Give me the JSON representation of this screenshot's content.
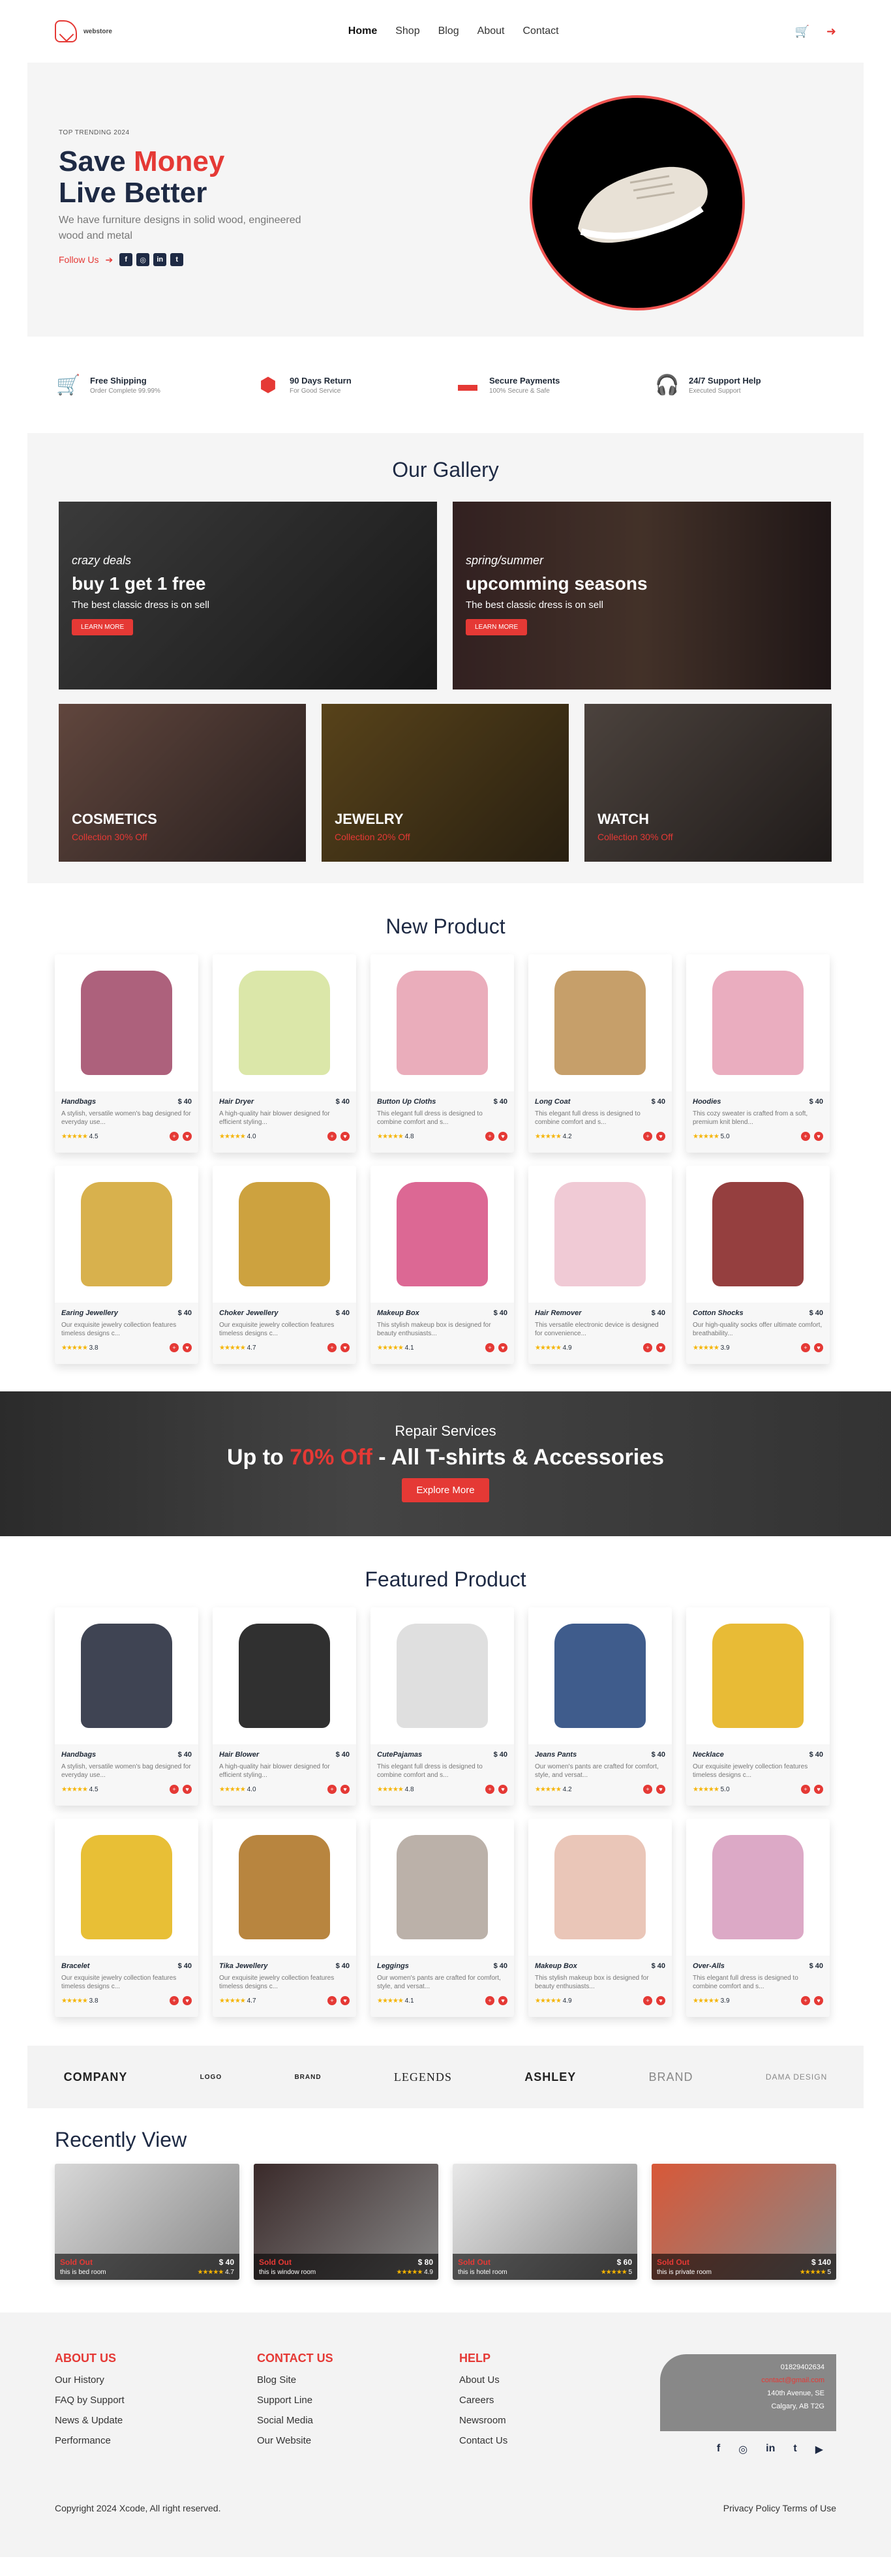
{
  "nav": {
    "brand": "webstore",
    "menu": [
      "Home",
      "Shop",
      "Blog",
      "About",
      "Contact"
    ],
    "active": "Home",
    "cart_icon": "cart-icon",
    "user_icon": "user-icon"
  },
  "hero": {
    "eyebrow": "TOP TRENDING 2024",
    "title_part1": "Save ",
    "title_red": "Money",
    "title_line2": "Live Better",
    "desc": "We have furniture designs in solid wood, engineered wood and metal",
    "follow": "Follow Us",
    "socials": [
      "f",
      "◎",
      "in",
      "t"
    ]
  },
  "features": [
    {
      "icon": "cart-icon",
      "title": "Free Shipping",
      "sub": "Order Complete 99.99%"
    },
    {
      "icon": "return-icon",
      "title": "90 Days Return",
      "sub": "For Good Service"
    },
    {
      "icon": "wallet-icon",
      "title": "Secure Payments",
      "sub": "100% Secure & Safe"
    },
    {
      "icon": "headset-icon",
      "title": "24/7 Support Help",
      "sub": "Executed Support"
    }
  ],
  "gallery": {
    "title": "Our Gallery",
    "big": [
      {
        "sub": "crazy deals",
        "head": "buy 1 get 1 free",
        "line": "The best classic dress is on sell",
        "btn": "LEARN MORE"
      },
      {
        "sub": "spring/summer",
        "head": "upcomming seasons",
        "line": "The best classic dress is on sell",
        "btn": "LEARN MORE"
      }
    ],
    "small": [
      {
        "cat": "COSMETICS",
        "off": "Collection 30% Off"
      },
      {
        "cat": "JEWELRY",
        "off": "Collection 20% Off"
      },
      {
        "cat": "WATCH",
        "off": "Collection 30% Off"
      }
    ]
  },
  "new_products": {
    "title": "New Product",
    "items": [
      {
        "name": "Handbags",
        "price": "$ 40",
        "desc": "A stylish, versatile women's bag designed for everyday use...",
        "rating": "4.5"
      },
      {
        "name": "Hair Dryer",
        "price": "$ 40",
        "desc": "A high-quality hair blower designed for efficient styling...",
        "rating": "4.0"
      },
      {
        "name": "Button Up Cloths",
        "price": "$ 40",
        "desc": "This elegant full dress is designed to combine comfort and s...",
        "rating": "4.8"
      },
      {
        "name": "Long Coat",
        "price": "$ 40",
        "desc": "This elegant full dress is designed to combine comfort and s...",
        "rating": "4.2"
      },
      {
        "name": "Hoodies",
        "price": "$ 40",
        "desc": "This cozy sweater is crafted from a soft, premium knit blend...",
        "rating": "5.0"
      },
      {
        "name": "Earing Jewellery",
        "price": "$ 40",
        "desc": "Our exquisite jewelry collection features timeless designs c...",
        "rating": "3.8"
      },
      {
        "name": "Choker Jewellery",
        "price": "$ 40",
        "desc": "Our exquisite jewelry collection features timeless designs c...",
        "rating": "4.7"
      },
      {
        "name": "Makeup Box",
        "price": "$ 40",
        "desc": "This stylish makeup box is designed for beauty enthusiasts...",
        "rating": "4.1"
      },
      {
        "name": "Hair Remover",
        "price": "$ 40",
        "desc": "This versatile electronic device is designed for convenience...",
        "rating": "4.9"
      },
      {
        "name": "Cotton Shocks",
        "price": "$ 40",
        "desc": "Our high-quality socks offer ultimate comfort, breathability...",
        "rating": "3.9"
      }
    ]
  },
  "banner": {
    "small": "Repair Services",
    "big_pre": "Up to ",
    "big_red": "70% Off",
    "big_post": " - All T-shirts & Accessories",
    "btn": "Explore More"
  },
  "featured_products": {
    "title": "Featured Product",
    "items": [
      {
        "name": "Handbags",
        "price": "$ 40",
        "desc": "A stylish, versatile women's bag designed for everyday use...",
        "rating": "4.5"
      },
      {
        "name": "Hair Blower",
        "price": "$ 40",
        "desc": "A high-quality hair blower designed for efficient styling...",
        "rating": "4.0"
      },
      {
        "name": "CutePajamas",
        "price": "$ 40",
        "desc": "This elegant full dress is designed to combine comfort and s...",
        "rating": "4.8"
      },
      {
        "name": "Jeans Pants",
        "price": "$ 40",
        "desc": "Our women's pants are crafted for comfort, style, and versat...",
        "rating": "4.2"
      },
      {
        "name": "Necklace",
        "price": "$ 40",
        "desc": "Our exquisite jewelry collection features timeless designs c...",
        "rating": "5.0"
      },
      {
        "name": "Bracelet",
        "price": "$ 40",
        "desc": "Our exquisite jewelry collection features timeless designs c...",
        "rating": "3.8"
      },
      {
        "name": "Tika Jewellery",
        "price": "$ 40",
        "desc": "Our exquisite jewelry collection features timeless designs c...",
        "rating": "4.7"
      },
      {
        "name": "Leggings",
        "price": "$ 40",
        "desc": "Our women's pants are crafted for comfort, style, and versat...",
        "rating": "4.1"
      },
      {
        "name": "Makeup Box",
        "price": "$ 40",
        "desc": "This stylish makeup box is designed for beauty enthusiasts...",
        "rating": "4.9"
      },
      {
        "name": "Over-Alls",
        "price": "$ 40",
        "desc": "This elegant full dress is designed to combine comfort and s...",
        "rating": "3.9"
      }
    ]
  },
  "brands": [
    "COMPANY",
    "LOGO",
    "BRAND",
    "LEGENDS",
    "ASHLEY",
    "BRAND",
    "DAMA DESIGN"
  ],
  "recent": {
    "title": "Recently View",
    "items": [
      {
        "price": "$ 40",
        "label": "Sold Out",
        "desc": "this is bed room",
        "rating": "4.7"
      },
      {
        "price": "$ 80",
        "label": "Sold Out",
        "desc": "this is window room",
        "rating": "4.9"
      },
      {
        "price": "$ 60",
        "label": "Sold Out",
        "desc": "this is hotel room",
        "rating": "5"
      },
      {
        "price": "$ 140",
        "label": "Sold Out",
        "desc": "this is private room",
        "rating": "5"
      }
    ]
  },
  "footer": {
    "about_title": "ABOUT US",
    "about": [
      "Our History",
      "FAQ by Support",
      "News & Update",
      "Performance"
    ],
    "contact_title": "CONTACT US",
    "contact": [
      "Blog Site",
      "Support Line",
      "Social Media",
      "Our Website"
    ],
    "help_title": "HELP",
    "help": [
      "About Us",
      "Careers",
      "Newsroom",
      "Contact Us"
    ],
    "phone": "01829402634",
    "email": "contact@gmail.com",
    "address1": "140th Avenue, SE",
    "address2": "Calgary, AB T2G",
    "icons": [
      "f",
      "◎",
      "in",
      "t",
      "▶"
    ],
    "copyright": "Copyright 2024 Xcode, All right reserved.",
    "links": "Privacy Policy Terms of Use"
  }
}
